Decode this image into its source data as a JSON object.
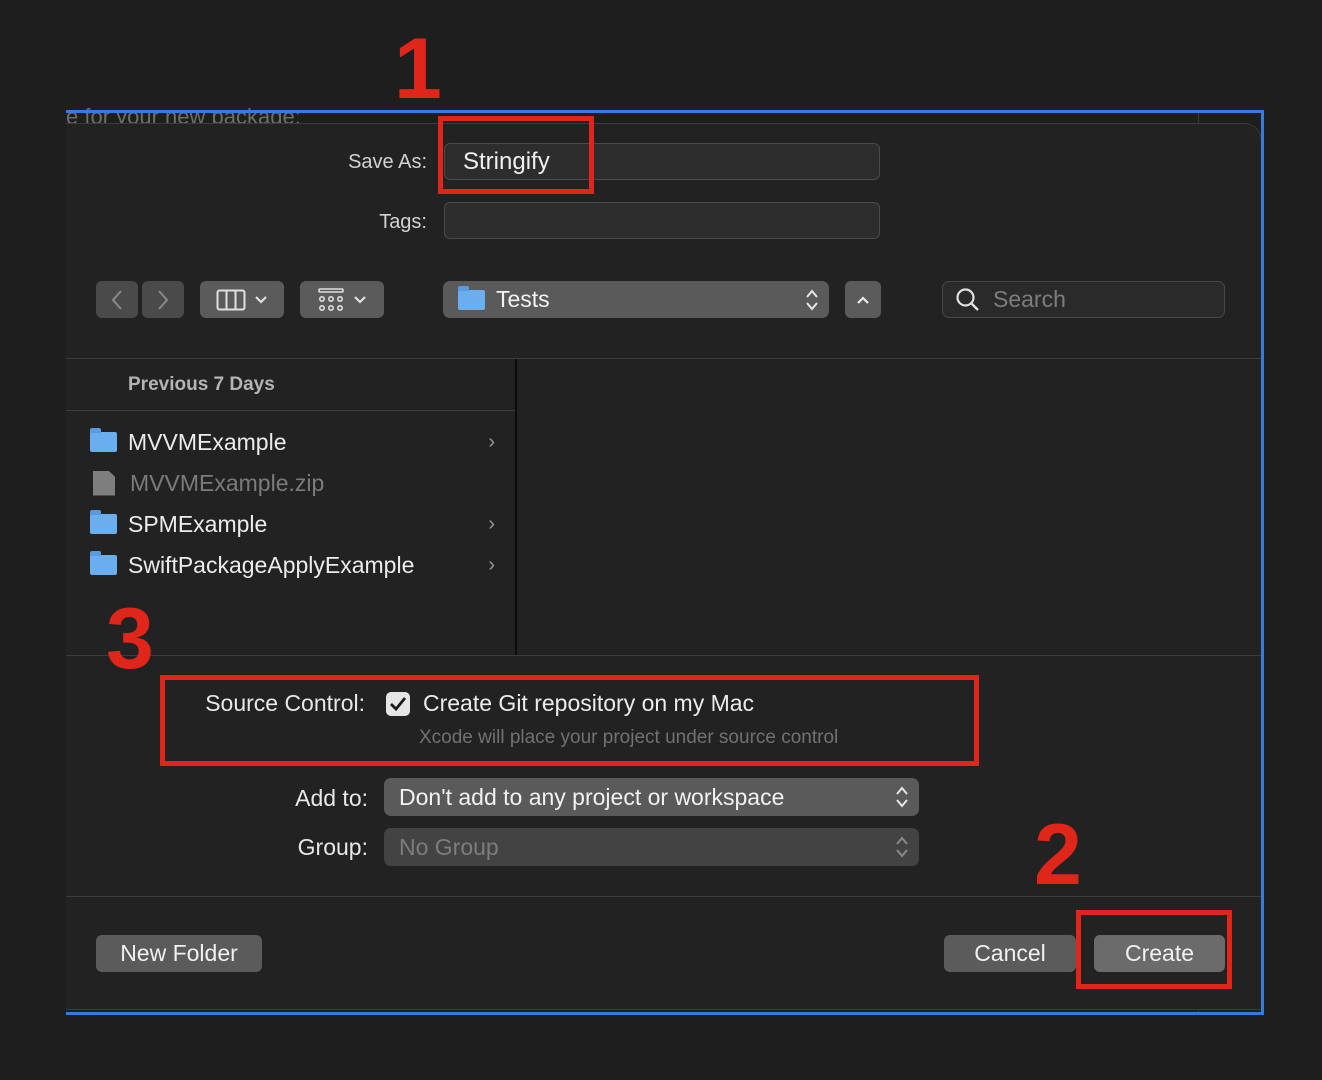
{
  "background_caption": "e for your new package:",
  "dialog": {
    "save_as": {
      "label": "Save As:",
      "value": "Stringify"
    },
    "tags": {
      "label": "Tags:",
      "value": ""
    },
    "toolbar": {
      "location": "Tests",
      "search_placeholder": "Search"
    },
    "sidebar": {
      "section_title": "Previous 7 Days",
      "items": [
        {
          "name": "MVVMExample",
          "kind": "folder",
          "has_chevron": true
        },
        {
          "name": "MVVMExample.zip",
          "kind": "file",
          "has_chevron": false
        },
        {
          "name": "SPMExample",
          "kind": "folder",
          "has_chevron": true
        },
        {
          "name": "SwiftPackageApplyExample",
          "kind": "folder",
          "has_chevron": true
        }
      ]
    },
    "source_control": {
      "label": "Source Control:",
      "checkbox_label": "Create Git repository on my Mac",
      "checked": true,
      "hint": "Xcode will place your project under source control"
    },
    "add_to": {
      "label": "Add to:",
      "value": "Don't add to any project or workspace"
    },
    "group": {
      "label": "Group:",
      "value": "No Group"
    },
    "buttons": {
      "new_folder": "New Folder",
      "cancel": "Cancel",
      "create": "Create"
    }
  },
  "annotations": {
    "step1": "1",
    "step2": "2",
    "step3": "3",
    "color": "#e0261b"
  },
  "colors": {
    "dialog_bg": "#222222",
    "selection_frame": "#3a7bd5",
    "folder_icon": "#6aaef0"
  }
}
